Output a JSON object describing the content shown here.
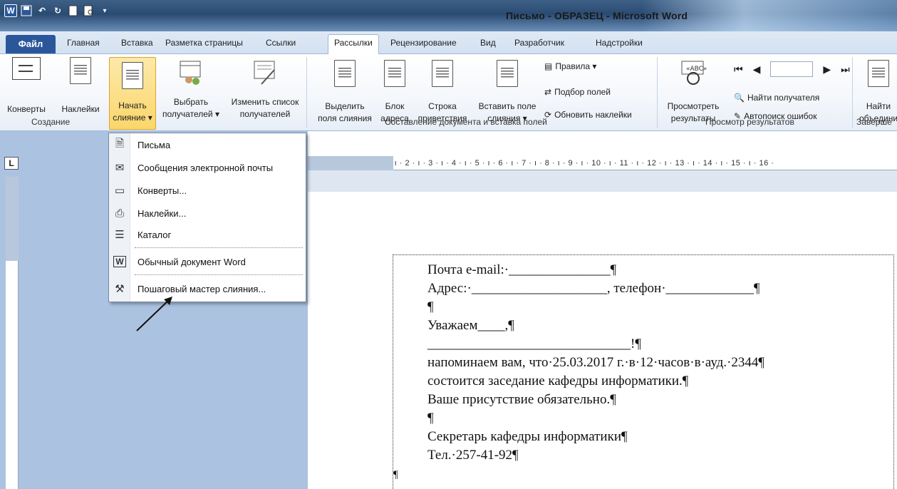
{
  "window": {
    "title": "Письмо - ОБРАЗЕЦ - Microsoft Word"
  },
  "tabs": {
    "file": "Файл",
    "items": [
      "Главная",
      "Вставка",
      "Разметка страницы",
      "Ссылки",
      "Рассылки",
      "Рецензирование",
      "Вид",
      "Разработчик",
      "Надстройки"
    ],
    "active": "Рассылки"
  },
  "ribbon": {
    "groups": {
      "create": "Создание",
      "compose": "Составление документа и вставка полей",
      "preview": "Просмотр результатов",
      "finish": "Заверше"
    },
    "buttons": {
      "envelopes": "Конверты",
      "labels": "Наклейки",
      "start_merge_1": "Начать",
      "start_merge_2": "слияние ▾",
      "select_recipients_1": "Выбрать",
      "select_recipients_2": "получателей ▾",
      "edit_list_1": "Изменить список",
      "edit_list_2": "получателей",
      "highlight_1": "Выделить",
      "highlight_2": "поля слияния",
      "address_1": "Блок",
      "address_2": "адреса",
      "greeting_1": "Строка",
      "greeting_2": "приветствия",
      "insert_field_1": "Вставить поле",
      "insert_field_2": "слияния ▾",
      "rules": "Правила ▾",
      "match_fields": "Подбор полей",
      "update_labels": "Обновить наклейки",
      "preview_1": "Просмотреть",
      "preview_2": "результаты",
      "find_recipient": "Найти получателя",
      "auto_check": "Автопоиск ошибок",
      "finish_1": "Найти",
      "finish_2": "объедини"
    }
  },
  "ruler": {
    "corner": "L",
    "marks": "· 2 · ı · 1 · ı · ·  ı · 1 · ı · 2 · ı · 3 · ı · 4 · ı · 5 · ı · 6 · ı · 7 · ı · 8 · ı · 9 · ı · 10 · ı · 11 · ı · 12 · ı · 13 · ı · 14 · ı · 15 · ı · 16 ·"
  },
  "menu": {
    "items": [
      {
        "label": "Письма",
        "icon": "letter-icon"
      },
      {
        "label": "Сообщения электронной почты",
        "icon": "email-icon"
      },
      {
        "label": "Конверты...",
        "icon": "envelope-icon"
      },
      {
        "label": "Наклейки...",
        "icon": "label-icon"
      },
      {
        "label": "Каталог",
        "icon": "catalog-icon"
      },
      {
        "label": "Обычный документ Word",
        "icon": "word-doc-icon"
      },
      {
        "label": "Пошаговый мастер слияния...",
        "icon": "wizard-icon"
      }
    ]
  },
  "document": {
    "lines": [
      "Почта e-mail:·_______________¶",
      "Адрес:·____________________, телефон·_____________¶",
      "¶",
      "Уважаем____,¶",
      "______________________________!¶",
      "напоминаем вам, что·25.03.2017 г.·в·12·часов·в·ауд.·2344¶",
      "состоится заседание кафедры информатики.¶",
      "Ваше присутствие обязательно.¶",
      "¶",
      "Секретарь кафедры информатики¶",
      "Тел.·257-41-92¶"
    ],
    "trailing_mark": "¶"
  }
}
